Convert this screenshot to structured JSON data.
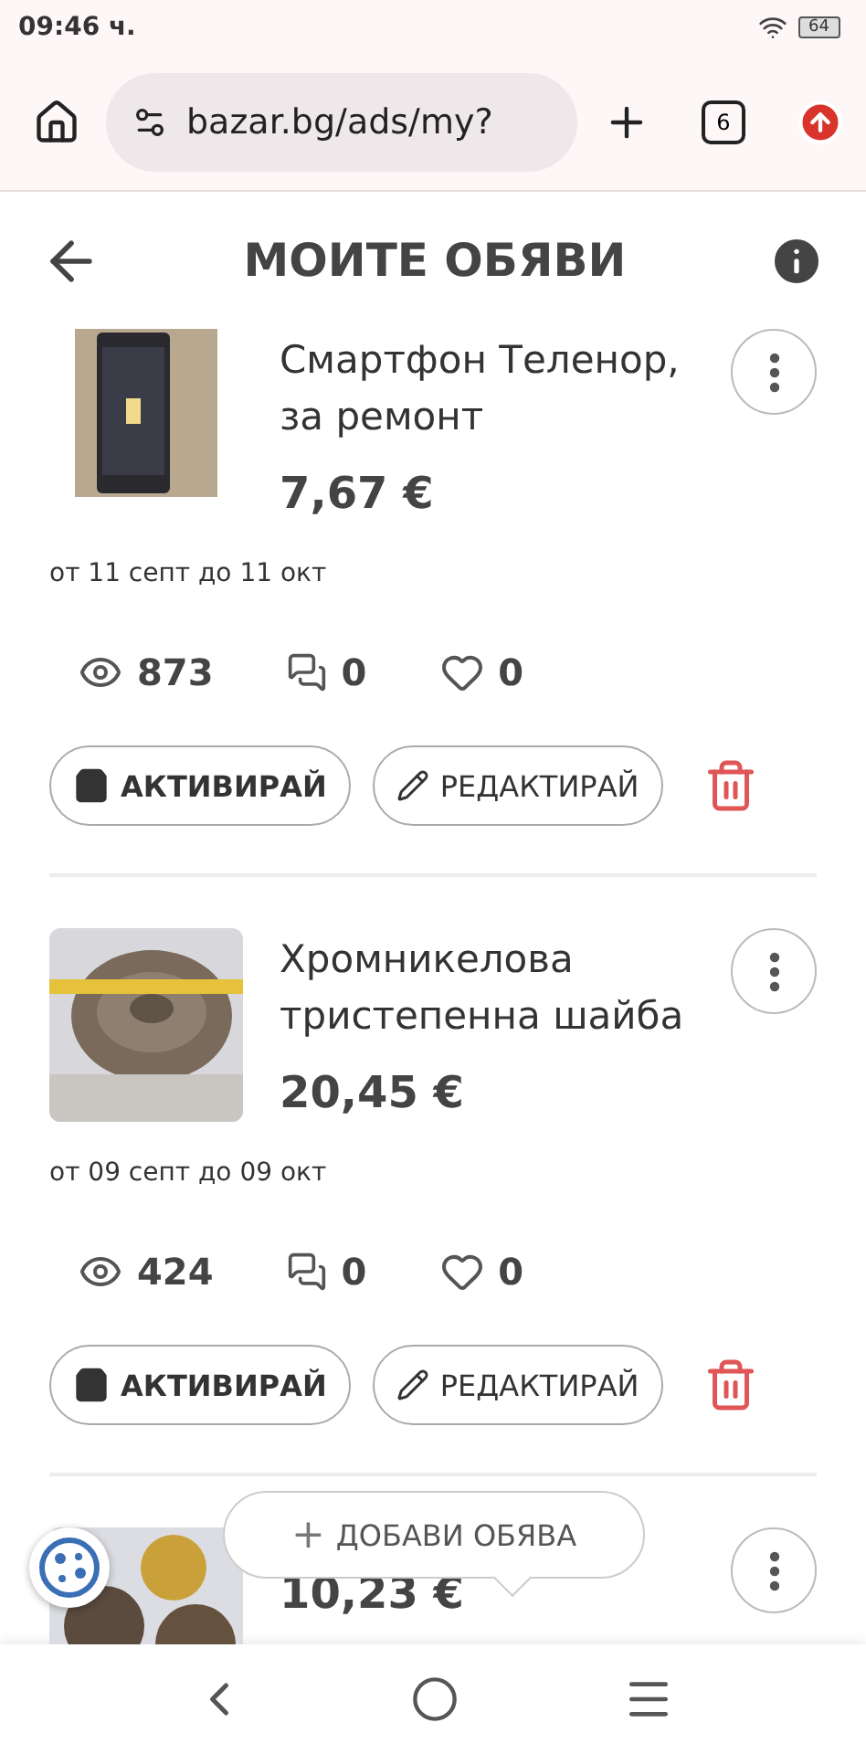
{
  "status_bar": {
    "time": "09:46 ч.",
    "battery": "64"
  },
  "browser": {
    "url": "bazar.bg/ads/my?",
    "tab_count": "6"
  },
  "header": {
    "title": "МОИТЕ ОБЯВИ"
  },
  "ads": [
    {
      "title": "Смартфон Теленор, за ремонт",
      "price": "7,67 €",
      "period": "от 11 септ до 11 окт",
      "views": "873",
      "messages": "0",
      "favorites": "0",
      "activate": "АКТИВИРАЙ",
      "edit": "РЕДАКТИРАЙ"
    },
    {
      "title": "Хромникелова тристепенна шайба",
      "price": "20,45 €",
      "period": "от 09 септ до 09 окт",
      "views": "424",
      "messages": "0",
      "favorites": "0",
      "activate": "АКТИВИРАЙ",
      "edit": "РЕДАКТИРАЙ"
    },
    {
      "price": "10,23 €"
    }
  ],
  "add_button": {
    "label": "ДОБАВИ ОБЯВА",
    "icon": "+"
  }
}
